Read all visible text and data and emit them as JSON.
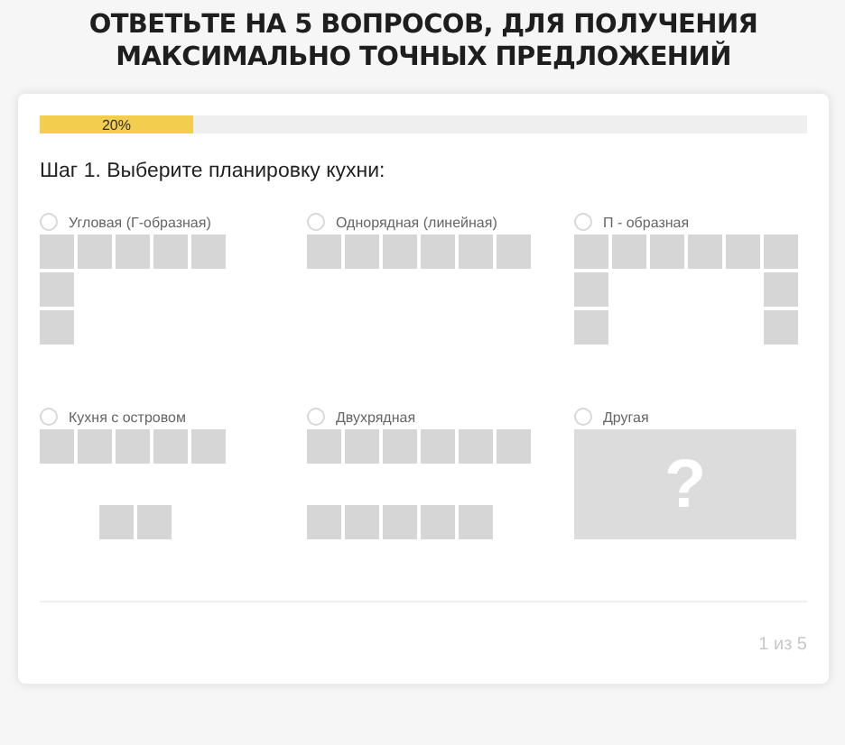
{
  "heading": "ОТВЕТЬТЕ НА 5 ВОПРОСОВ, ДЛЯ ПОЛУЧЕНИЯ МАКСИМАЛЬНО ТОЧНЫХ ПРЕДЛОЖЕНИЙ",
  "progress": {
    "level": 0.2,
    "label": "20%"
  },
  "question": "Шаг 1. Выберите планировку кухни:",
  "options": [
    {
      "label": "Угловая (Г-образная)",
      "selected": false,
      "kind": "corner"
    },
    {
      "label": "Однорядная (линейная)",
      "selected": false,
      "kind": "linear"
    },
    {
      "label": "П - образная",
      "selected": false,
      "kind": "u-shape"
    },
    {
      "label": "Кухня с островом",
      "selected": false,
      "kind": "island"
    },
    {
      "label": "Двухрядная",
      "selected": false,
      "kind": "double"
    },
    {
      "label": "Другая",
      "selected": false,
      "kind": "other",
      "symbol": "?"
    }
  ],
  "pager": "1 из 5"
}
